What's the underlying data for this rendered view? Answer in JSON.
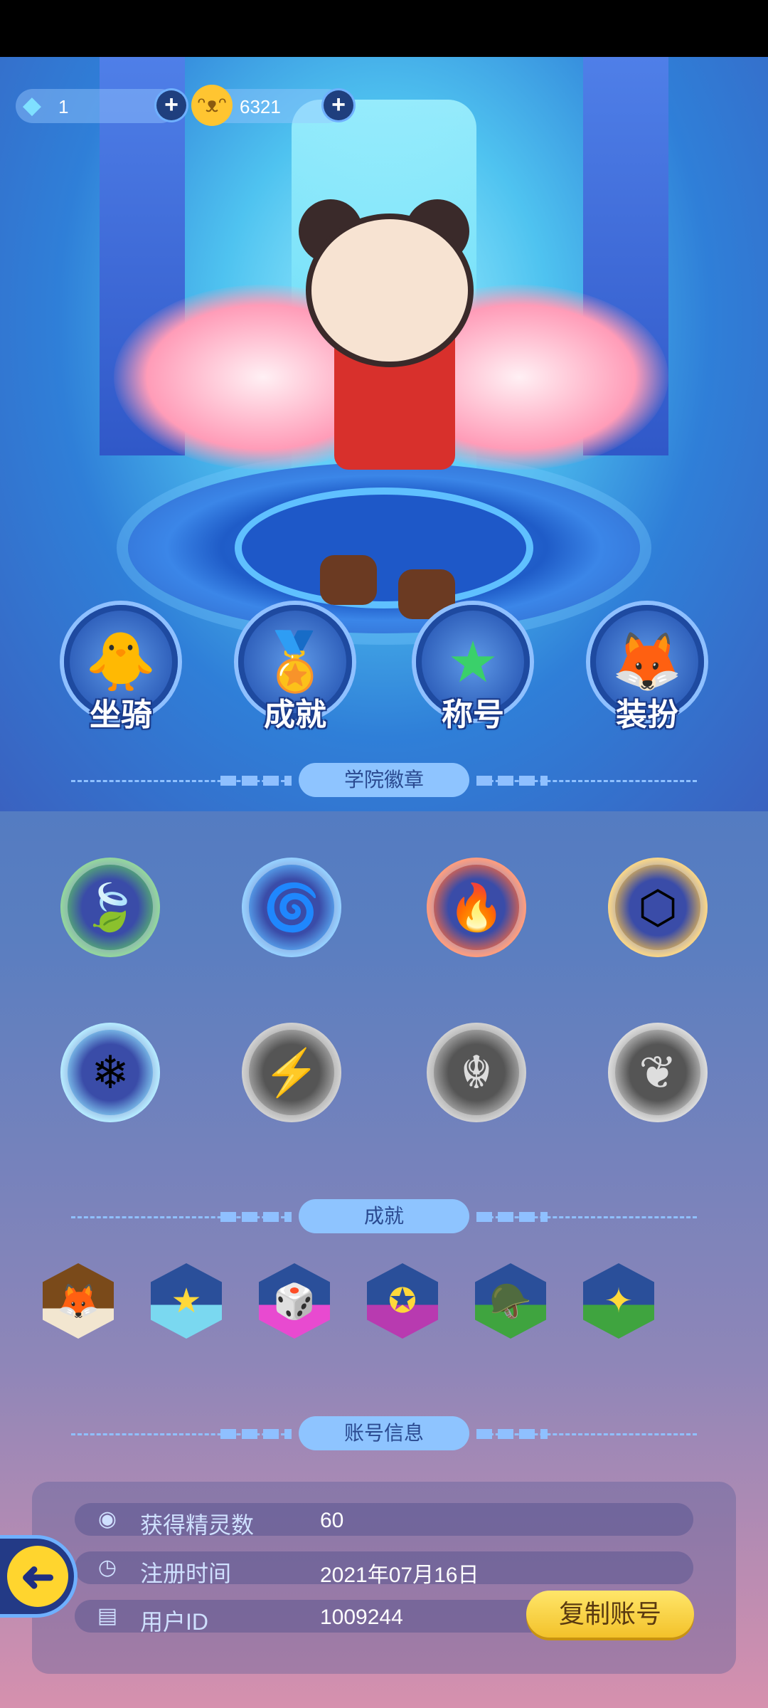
{
  "currencies": [
    {
      "icon": "diamond-icon",
      "value": "1"
    },
    {
      "icon": "cat-coin-icon",
      "value": "6321"
    }
  ],
  "menu": [
    {
      "label": "坐骑",
      "icon": "duck-icon"
    },
    {
      "label": "成就",
      "icon": "medal-icon"
    },
    {
      "label": "称号",
      "icon": "star-shield-icon"
    },
    {
      "label": "装扮",
      "icon": "sweater-icon"
    }
  ],
  "sections": {
    "badges": "学院徽章",
    "achievements": "成就",
    "account": "账号信息"
  },
  "badges": [
    {
      "icon": "leaf-badge-icon",
      "color": "#4caf50",
      "unlocked": true
    },
    {
      "icon": "water-badge-icon",
      "color": "#3fa8ff",
      "unlocked": true
    },
    {
      "icon": "fire-badge-icon",
      "color": "#ff5a3a",
      "unlocked": true
    },
    {
      "icon": "earth-badge-icon",
      "color": "#f3b13a",
      "unlocked": true
    },
    {
      "icon": "ice-badge-icon",
      "color": "#7fd4ff",
      "unlocked": true
    },
    {
      "icon": "lightning-badge-icon",
      "color": "#9a9a9a",
      "unlocked": false
    },
    {
      "icon": "dragon-badge-icon",
      "color": "#9a9a9a",
      "unlocked": false
    },
    {
      "icon": "wing-badge-icon",
      "color": "#9a9a9a",
      "unlocked": false
    }
  ],
  "achievements": [
    {
      "icon": "fox-icon",
      "color": "#c8873a"
    },
    {
      "icon": "star-wreath-icon",
      "color": "#3fb4e8"
    },
    {
      "icon": "dice-icon",
      "color": "#e040c8"
    },
    {
      "icon": "wing-crest-icon",
      "color": "#b03aa8"
    },
    {
      "icon": "soldier-icon",
      "color": "#3e9a3e"
    },
    {
      "icon": "military-crest-icon",
      "color": "#3e9a3e"
    }
  ],
  "account": {
    "rows": [
      {
        "icon": "pokeball-icon",
        "label": "获得精灵数",
        "value": "60"
      },
      {
        "icon": "clock-icon",
        "label": "注册时间",
        "value": "2021年07月16日"
      },
      {
        "icon": "id-card-icon",
        "label": "用户ID",
        "value": "1009244"
      }
    ],
    "copy_label": "复制账号"
  }
}
